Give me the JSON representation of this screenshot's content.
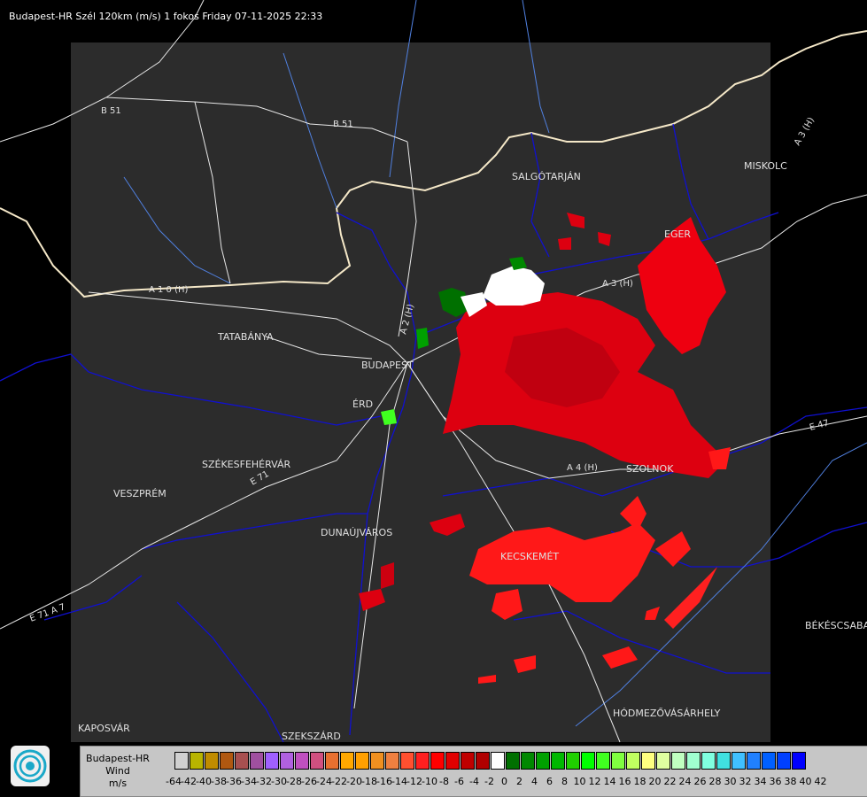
{
  "header": {
    "title": "Budapest-HR Szél 120km (m/s) 1 fokos Friday 07-11-2025 22:33"
  },
  "cities": [
    {
      "name": "SALGÓTARJÁN",
      "key": "salgotarjan"
    },
    {
      "name": "EGER",
      "key": "eger"
    },
    {
      "name": "MISKOLC",
      "key": "miskolc"
    },
    {
      "name": "TATABÁNYA",
      "key": "tatabanya"
    },
    {
      "name": "BUDAPEST",
      "key": "budapest"
    },
    {
      "name": "ÉRD",
      "key": "erd"
    },
    {
      "name": "SZÉKESFEHÉRVÁR",
      "key": "szekesfehervar"
    },
    {
      "name": "VESZPRÉM",
      "key": "veszprem"
    },
    {
      "name": "DUNAÚJVÁROS",
      "key": "dunaujvaros"
    },
    {
      "name": "KECSKEMÉT",
      "key": "kecskemet"
    },
    {
      "name": "SZOLNOK",
      "key": "szolnok"
    },
    {
      "name": "BÉKÉSCSABA",
      "key": "bekescsaba"
    },
    {
      "name": "HÓDMEZŐVÁSÁRHELY",
      "key": "hodmezovasarhely"
    },
    {
      "name": "KAPOSVÁR",
      "key": "kaposvar"
    },
    {
      "name": "SZEKSZÁRD",
      "key": "szekszard"
    }
  ],
  "roads": [
    "B 51",
    "B 51",
    "A 1 0 (H)",
    "A 2 (H)",
    "A 3 (H)",
    "A 3 (H)",
    "E 71",
    "A 4 (H)",
    "E 47",
    "E 71 A 7"
  ],
  "legend": {
    "station": "Budapest-HR",
    "product": "Wind",
    "unit": "m/s",
    "ticks": [
      "-64",
      "-42",
      "-40",
      "-38",
      "-36",
      "-34",
      "-32",
      "-30",
      "-28",
      "-26",
      "-24",
      "-22",
      "-20",
      "-18",
      "-16",
      "-14",
      "-12",
      "-10",
      "-8",
      "-6",
      "-4",
      "-2",
      "0",
      "2",
      "4",
      "6",
      "8",
      "10",
      "12",
      "14",
      "16",
      "18",
      "20",
      "22",
      "24",
      "26",
      "28",
      "30",
      "32",
      "34",
      "36",
      "38",
      "40",
      "42"
    ],
    "colors": [
      "#d0d0d0",
      "#b8b400",
      "#c08c00",
      "#b05810",
      "#a85050",
      "#a050a0",
      "#a060ff",
      "#b060e0",
      "#c050c0",
      "#d05080",
      "#e87030",
      "#ffa800",
      "#ffa000",
      "#f09020",
      "#f08040",
      "#ff5030",
      "#ff2020",
      "#ff0000",
      "#e00000",
      "#c00000",
      "#b00000",
      "#ffffff",
      "#007000",
      "#008800",
      "#00a000",
      "#00b800",
      "#20d000",
      "#00ff00",
      "#40ff20",
      "#80ff40",
      "#c0ff60",
      "#ffff80",
      "#e0ffa0",
      "#c0ffc0",
      "#a0ffd0",
      "#80ffe0",
      "#40e0e0",
      "#40c0ff",
      "#2080ff",
      "#0060ff",
      "#0040ff",
      "#0000ff"
    ]
  },
  "colors": {
    "background": "#000000",
    "radar_area": "#2c2c2c",
    "echo_red": "#e00010",
    "echo_bright": "#ff2020"
  }
}
